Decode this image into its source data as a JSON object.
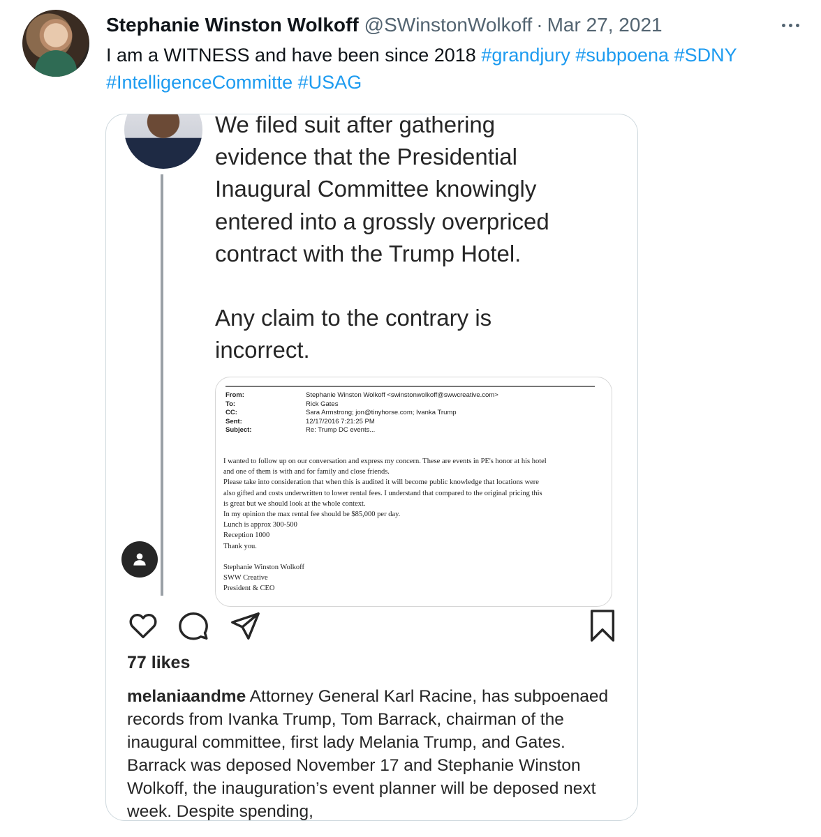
{
  "tweet": {
    "author_name": "Stephanie Winston Wolkoff",
    "handle": "@SWinstonWolkoff",
    "separator": "·",
    "date": "Mar 27, 2021",
    "text": "I am a WITNESS and have been since 2018 ",
    "hashtags": [
      "#grandjury",
      "#subpoena",
      "#SDNY",
      "#IntelligenceCommitte",
      "#USAG"
    ]
  },
  "embedded_post": {
    "statement_paragraph_1": "We filed suit after gathering\nevidence that the Presidential\nInaugural Committee knowingly\nentered into a grossly overpriced\ncontract with the Trump Hotel.",
    "statement_paragraph_2": "Any claim to the contrary is\nincorrect.",
    "email": {
      "header_rows": [
        {
          "key": "From:",
          "value": "Stephanie Winston Wolkoff <swinstonwolkoff@swwcreative.com>"
        },
        {
          "key": "To:",
          "value": "Rick Gates"
        },
        {
          "key": "CC:",
          "value": "Sara Armstrong; jon@tinyhorse.com; Ivanka Trump"
        },
        {
          "key": "Sent:",
          "value": "12/17/2016 7:21:25 PM"
        },
        {
          "key": "Subject:",
          "value": "Re: Trump DC events..."
        }
      ],
      "body_lines": [
        "I wanted to follow up on our conversation and express my concern. These are events in PE's honor at his hotel",
        "and one of them is with and for family and close friends.",
        "Please take into consideration that when this is audited it will become public knowledge that locations were",
        "also gifted and costs underwritten to lower rental fees. I understand that compared to the original pricing this",
        "is great but we should look at the whole context.",
        "In my opinion the max rental fee should be $85,000 per day.",
        "Lunch is approx 300-500",
        "Reception 1000",
        "Thank you.",
        "",
        "Stephanie Winston Wolkoff",
        "SWW Creative",
        "President & CEO"
      ]
    },
    "likes": "77 likes",
    "caption_user": "melaniaandme",
    "caption_text": " Attorney General Karl Racine, has subpoenaed records from Ivanka Trump, Tom Barrack, chairman of the inaugural committee, first lady Melania Trump, and Gates. Barrack was deposed November 17 and Stephanie Winston Wolkoff, the inauguration’s event planner will be deposed next week. Despite spending,"
  },
  "icons": {
    "more": "more-options-icon",
    "like": "heart-icon",
    "comment": "comment-icon",
    "share": "send-icon",
    "save": "bookmark-icon",
    "user": "user-icon"
  },
  "colors": {
    "link": "#1d9bf0",
    "secondary_text": "#536471",
    "border": "#cfd9de"
  }
}
